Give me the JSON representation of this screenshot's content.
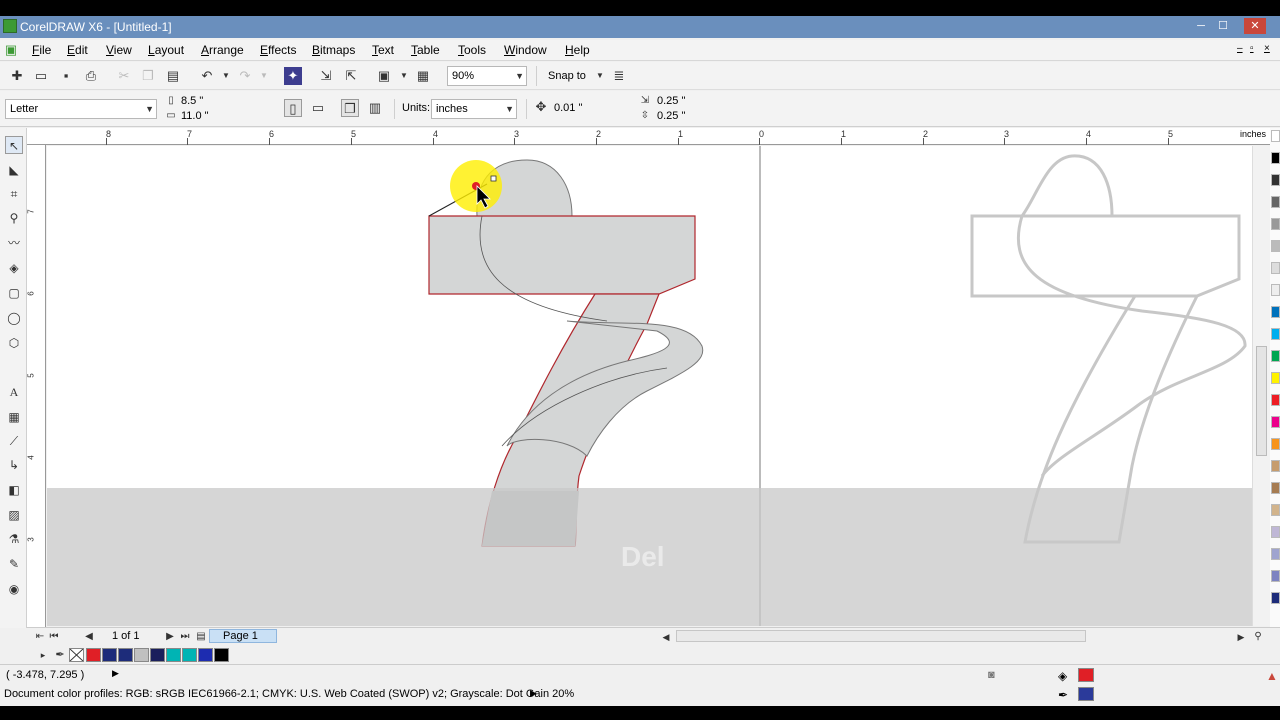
{
  "window": {
    "title": "CorelDRAW X6 - [Untitled-1]",
    "minimize": "─",
    "maximize": "☐",
    "close": "✕"
  },
  "menu": {
    "items": [
      "File",
      "Edit",
      "View",
      "Layout",
      "Arrange",
      "Effects",
      "Bitmaps",
      "Text",
      "Table",
      "Tools",
      "Window",
      "Help"
    ]
  },
  "toolbar": {
    "zoom": "90%",
    "snap_to": "Snap to"
  },
  "property_bar": {
    "page_size": "Letter",
    "width": "8.5 \"",
    "height": "11.0 \"",
    "units_label": "Units:",
    "units_value": "inches",
    "nudge": "0.01 \"",
    "dup_x": "0.25 \"",
    "dup_y": "0.25 \""
  },
  "ruler": {
    "unit_label": "inches",
    "h_ticks": [
      "8",
      "7",
      "6",
      "5",
      "4",
      "3",
      "2",
      "1",
      "0",
      "1",
      "2",
      "3",
      "4",
      "5"
    ],
    "v_ticks": [
      "7",
      "6",
      "5",
      "4",
      "3"
    ]
  },
  "canvas": {
    "overlay_text": "Del"
  },
  "page_nav": {
    "page_count": "1 of 1",
    "page_tab": "Page 1"
  },
  "status": {
    "coords": "( -3.478, 7.295 )",
    "color_profiles": "Document color profiles: RGB: sRGB IEC61966-2.1; CMYK: U.S. Web Coated (SWOP) v2; Grayscale: Dot Gain 20%"
  },
  "colors": {
    "accent": "#6a8fbd",
    "fill_swatch": "#e01f26",
    "outline_swatch": "#2b3a9a",
    "shape_fill": "#d4d6d6",
    "shape_outline": "#b0272d",
    "highlight": "#ffef00"
  },
  "doc_palette": [
    "#e01f26",
    "#1d2c7a",
    "#c0c0c0",
    "#1a1f5c",
    "#00b4b4",
    "#1d2cb0",
    "#000000"
  ],
  "right_palette": [
    "#ffffff",
    "#000000",
    "#333333",
    "#666666",
    "#999999",
    "#bbbbbb",
    "#dddddd",
    "#eeeeee",
    "#0072bc",
    "#00aeef",
    "#00a651",
    "#fff200",
    "#ed1c24",
    "#ec008c",
    "#f7941d",
    "#c69c6d",
    "#a67c52",
    "#d2b48c",
    "#bfb7d6",
    "#9fa4cf",
    "#7d83c1",
    "#1d2c7a"
  ]
}
